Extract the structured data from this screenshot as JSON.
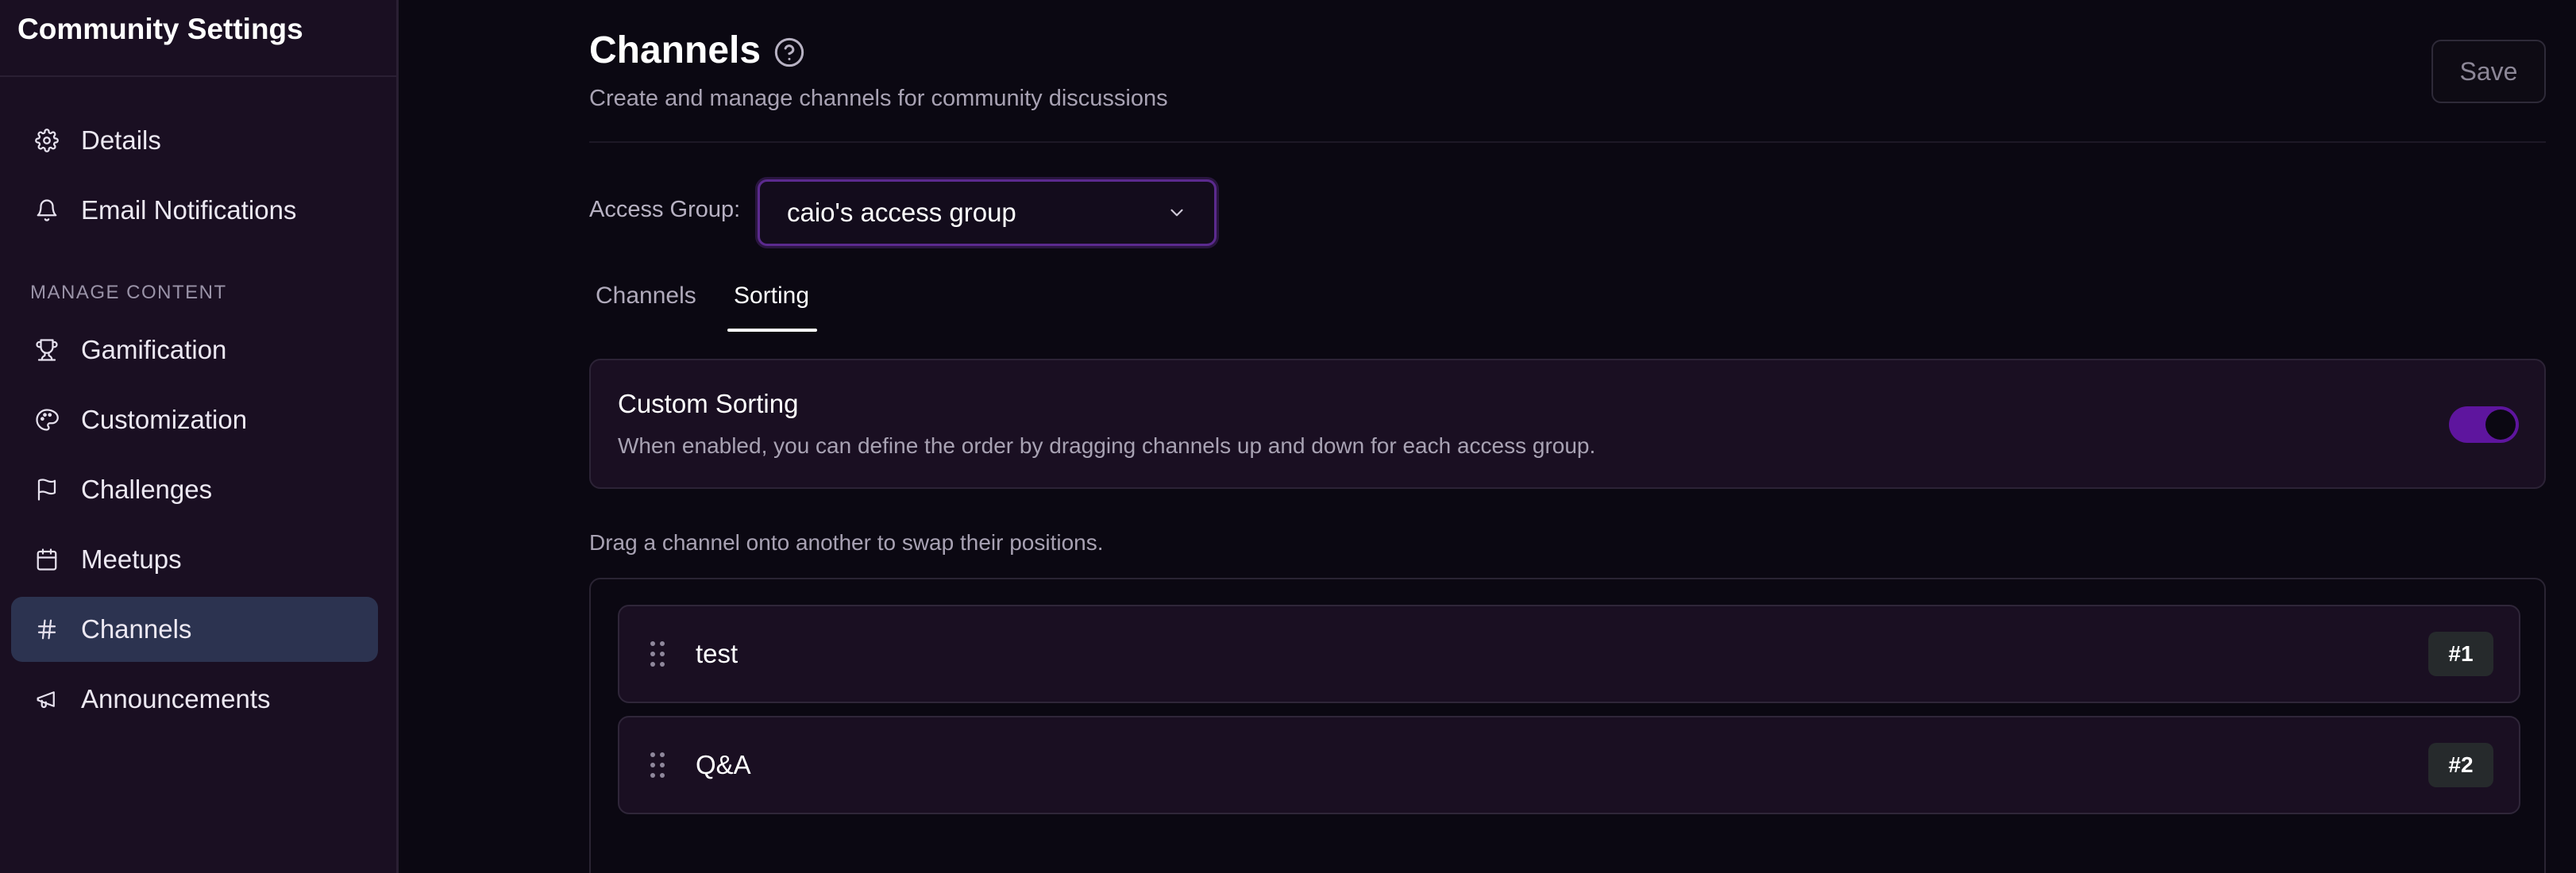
{
  "sidebar": {
    "title": "Community Settings",
    "items_top": [
      {
        "label": "Details",
        "icon": "gear-icon"
      },
      {
        "label": "Email Notifications",
        "icon": "bell-icon"
      }
    ],
    "section_label": "MANAGE CONTENT",
    "items_content": [
      {
        "label": "Gamification",
        "icon": "trophy-icon"
      },
      {
        "label": "Customization",
        "icon": "palette-icon"
      },
      {
        "label": "Challenges",
        "icon": "flag-icon"
      },
      {
        "label": "Meetups",
        "icon": "calendar-icon"
      },
      {
        "label": "Channels",
        "icon": "hash-icon",
        "active": true
      },
      {
        "label": "Announcements",
        "icon": "megaphone-icon"
      }
    ]
  },
  "header": {
    "title": "Channels",
    "subtitle": "Create and manage channels for community discussions",
    "save_label": "Save"
  },
  "access_group": {
    "label": "Access Group:",
    "selected": "caio's access group"
  },
  "tabs": [
    {
      "label": "Channels",
      "active": false
    },
    {
      "label": "Sorting",
      "active": true
    }
  ],
  "custom_sorting": {
    "title": "Custom Sorting",
    "description": "When enabled, you can define the order by dragging channels up and down for each access group.",
    "enabled": true
  },
  "drag_hint": "Drag a channel onto another to swap their positions.",
  "channels": [
    {
      "name": "test",
      "position": "#1"
    },
    {
      "name": "Q&A",
      "position": "#2"
    }
  ],
  "colors": {
    "accent": "#5e159e",
    "active_nav": "#2c3350",
    "sidebar_bg": "#1a0f22",
    "page_bg": "#0b0812"
  }
}
